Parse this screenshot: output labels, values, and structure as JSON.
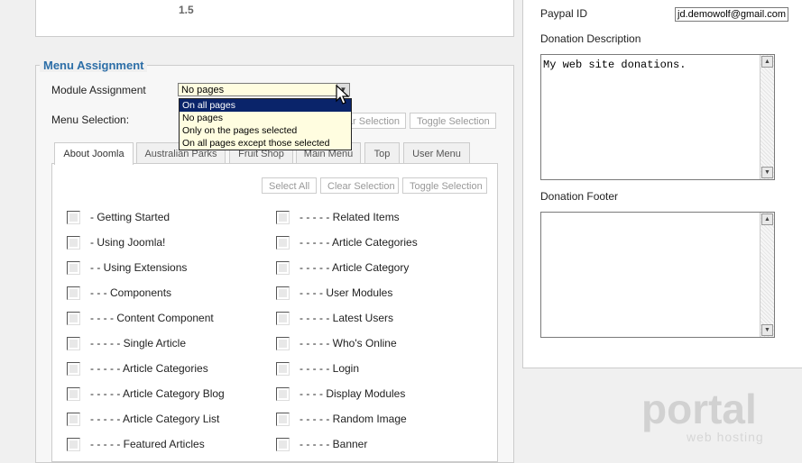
{
  "top": {
    "version": "1.5"
  },
  "menu_assignment": {
    "legend": "Menu Assignment",
    "module_assignment_label": "Module Assignment",
    "menu_selection_label": "Menu Selection:",
    "select_value": "No pages",
    "dropdown_options": [
      "On all pages",
      "No pages",
      "Only on the pages selected",
      "On all pages except those selected"
    ],
    "outer_buttons": {
      "clear_partial": "ar Selection",
      "toggle": "Toggle Selection"
    },
    "tabs": [
      "About Joomla",
      "Australian Parks",
      "Fruit Shop",
      "Main Menu",
      "Top",
      "User Menu"
    ],
    "inner_buttons": {
      "select_all": "Select All",
      "clear": "Clear Selection",
      "toggle": "Toggle Selection"
    },
    "items_left": [
      "- Getting Started",
      "- Using Joomla!",
      "- - Using Extensions",
      "- - - Components",
      "- - - - Content Component",
      "- - - - - Single Article",
      "- - - - - Article Categories",
      "- - - - - Article Category Blog",
      "- - - - - Article Category List",
      "- - - - - Featured Articles"
    ],
    "items_right": [
      "- - - - - Related Items",
      "- - - - - Article Categories",
      "- - - - - Article Category",
      "- - - - User Modules",
      "- - - - - Latest Users",
      "- - - - - Who's Online",
      "- - - - - Login",
      "- - - - Display Modules",
      "- - - - - Random Image",
      "- - - - - Banner"
    ]
  },
  "donation": {
    "paypal_label": "Paypal ID",
    "paypal_value": "jd.demowolf@gmail.com",
    "description_label": "Donation Description",
    "description_value": "My web site donations.",
    "footer_label": "Donation Footer",
    "footer_value": ""
  },
  "watermark": {
    "brand": "portal",
    "tagline": "web hosting"
  }
}
